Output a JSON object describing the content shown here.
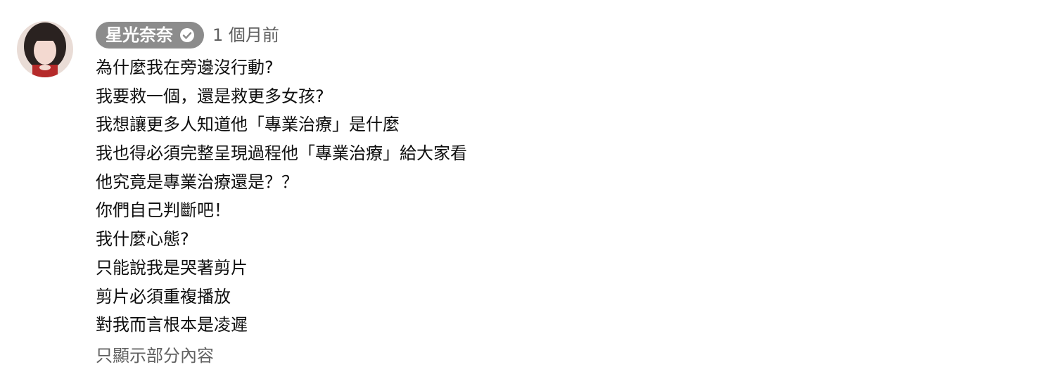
{
  "comment": {
    "author": "星光奈奈",
    "verified_icon": "check-circle-icon",
    "timestamp": "1 個月前",
    "lines": [
      "為什麼我在旁邊沒行動?",
      "我要救一個，還是救更多女孩?",
      "我想讓更多人知道他「專業治療」是什麼",
      "我也得必須完整呈現過程他「專業治療」給大家看",
      "他究竟是專業治療還是？？",
      "你們自己判斷吧！",
      "我什麼心態?",
      "只能說我是哭著剪片",
      "剪片必須重複播放",
      "對我而言根本是凌遲"
    ],
    "read_more": "只顯示部分內容"
  },
  "colors": {
    "chip_bg": "#8c8c8c",
    "text": "#0f0f0f",
    "secondary": "#606060"
  }
}
